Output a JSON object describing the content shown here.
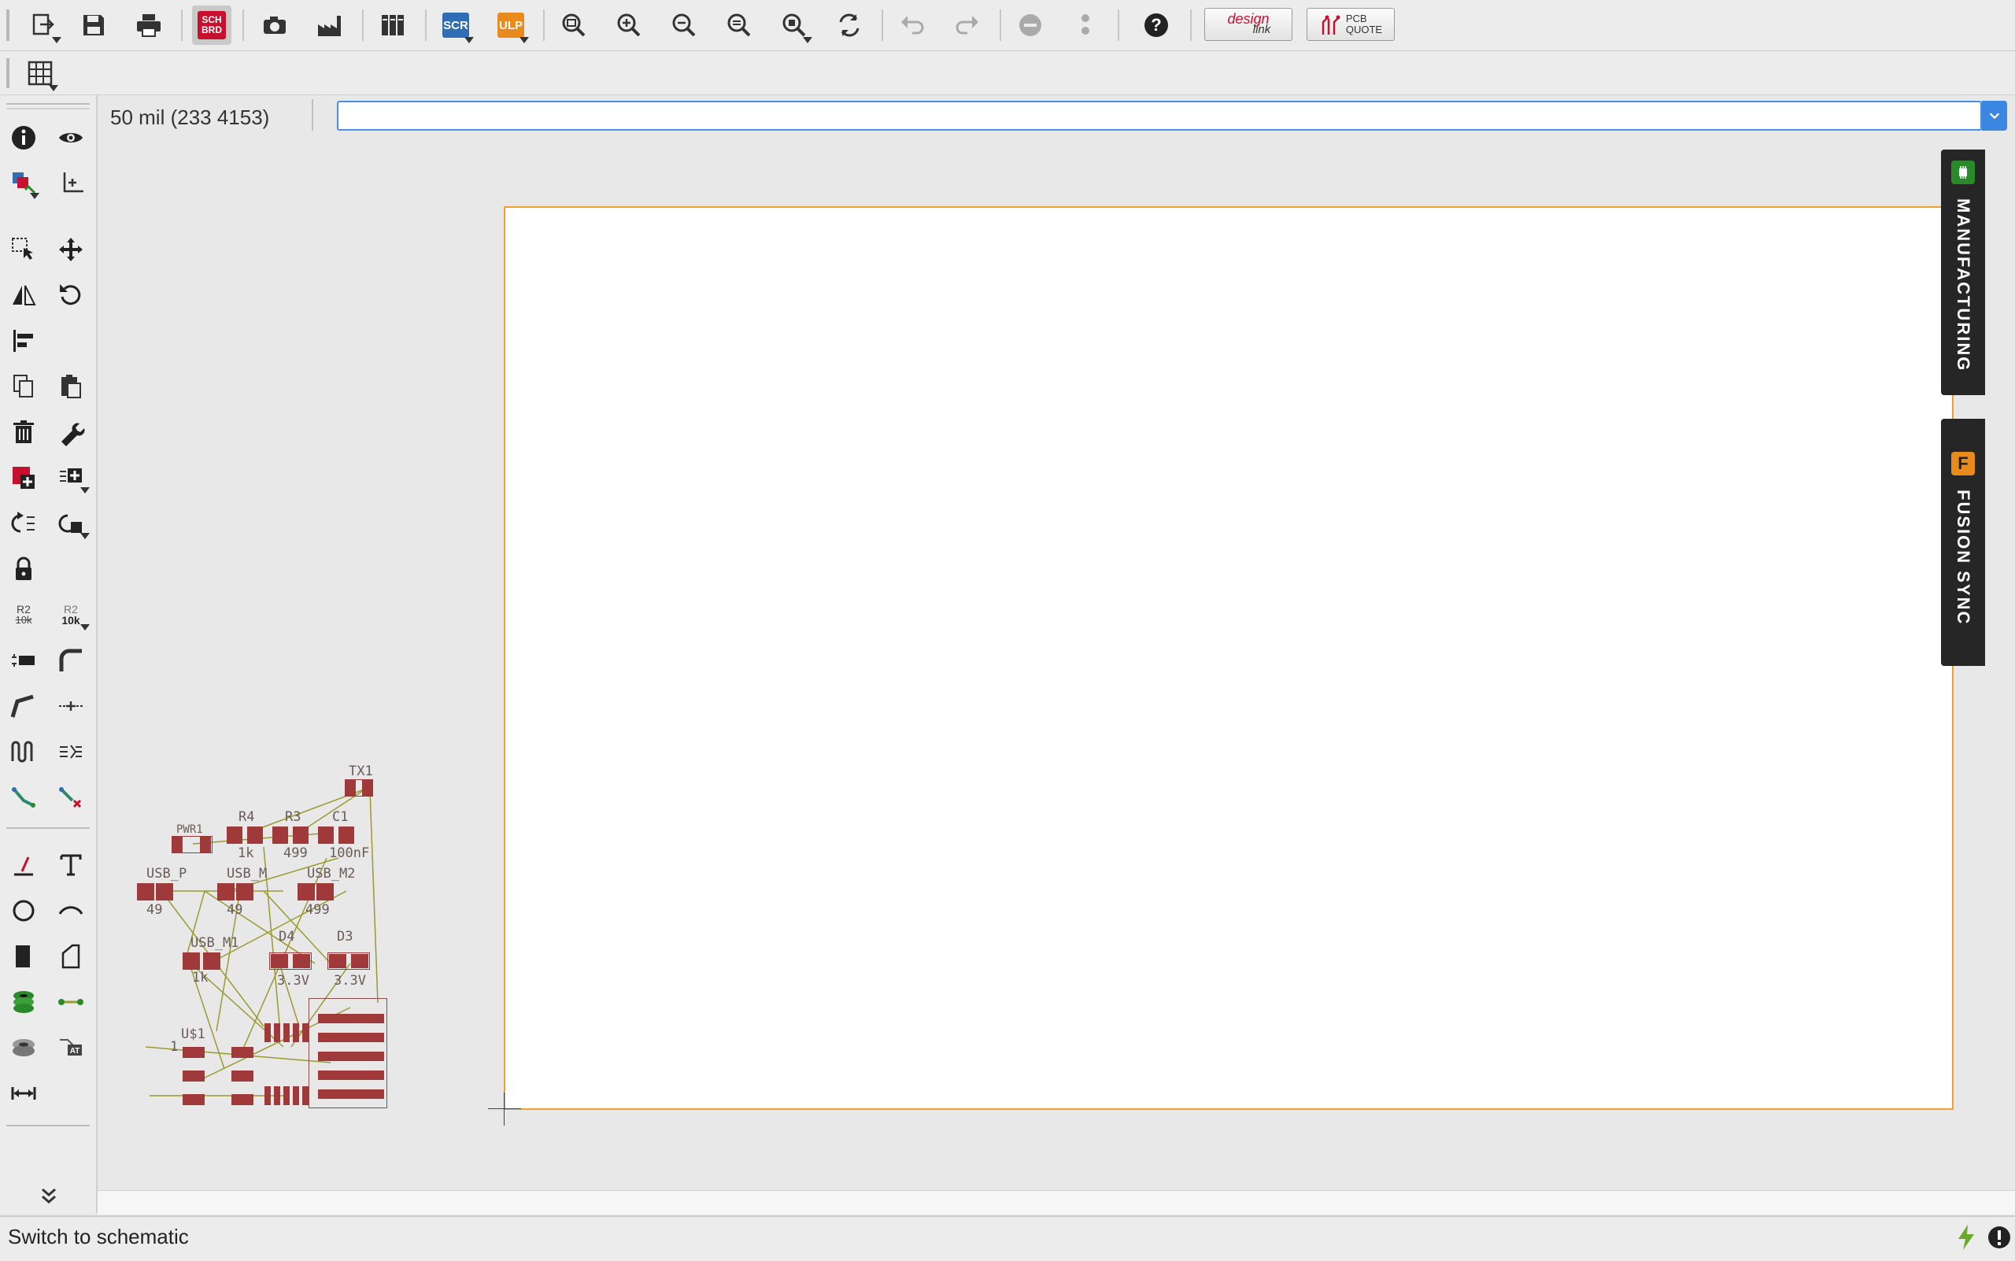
{
  "toolbar": {
    "buttons": [
      {
        "name": "open-icon"
      },
      {
        "name": "save-icon"
      },
      {
        "name": "print-icon"
      },
      {
        "name": "sch-brd-switch-icon",
        "label": "SCH\nBRD"
      },
      {
        "name": "cam-processor-icon"
      },
      {
        "name": "manufacturing-icon"
      },
      {
        "name": "library-icon"
      },
      {
        "name": "script-icon",
        "label": "SCR"
      },
      {
        "name": "ulp-icon",
        "label": "ULP"
      },
      {
        "name": "zoom-fit-icon"
      },
      {
        "name": "zoom-in-icon"
      },
      {
        "name": "zoom-out-icon"
      },
      {
        "name": "zoom-select-icon"
      },
      {
        "name": "zoom-area-icon"
      },
      {
        "name": "redraw-icon"
      },
      {
        "name": "undo-icon"
      },
      {
        "name": "redo-icon"
      },
      {
        "name": "stop-icon"
      },
      {
        "name": "go-icon"
      },
      {
        "name": "help-icon"
      }
    ],
    "design_link": {
      "line1": "design",
      "line2": "link"
    },
    "pcb_quote": {
      "line1": "PCB",
      "line2": "QUOTE"
    },
    "colors": {
      "accent": "#c8102e",
      "scr_blue": "#2f6db5",
      "ulp_orange": "#e98a1c"
    }
  },
  "command": {
    "coordinate_readout": "50 mil (233 4153)",
    "input_value": "",
    "input_placeholder": ""
  },
  "side_panels": {
    "manufacturing": "MANUFACTURING",
    "fusion_sync": "FUSION SYNC",
    "fusion_letter": "F"
  },
  "palette": {
    "value_label_a": "R2",
    "value_label_b": "10k"
  },
  "board": {
    "labels": {
      "tx1": "TX1",
      "pwr1": "PWR1",
      "r4": "R4",
      "r4_val": "1k",
      "r3": "R3",
      "r3_val": "499",
      "c1": "C1",
      "c1_val": "100nF",
      "usb_p": "USB_P",
      "usb_p_val": "49",
      "usb_m": "USB_M",
      "usb_m_val": "49",
      "usb_m2": "USB_M2",
      "usb_m2_val": "499",
      "usb_m1": "USB_M1",
      "usb_m1_val": "1k",
      "d4": "D4",
      "d4_val": "3.3V",
      "d3": "D3",
      "d3_val": "3.3V",
      "u1": "U$1",
      "u1_pin": "1"
    },
    "frame_color": "#f0a030",
    "pad_color": "#a03a3a",
    "airwire_color": "#9a9a30"
  },
  "status": {
    "text": "Switch to schematic"
  }
}
